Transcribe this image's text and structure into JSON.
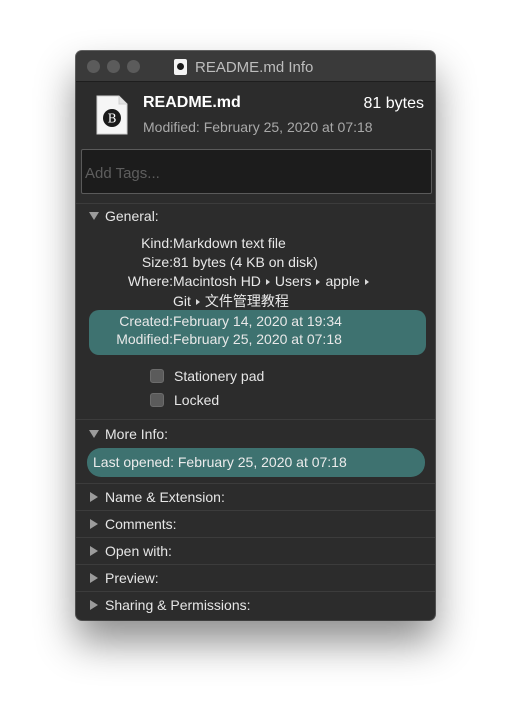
{
  "window": {
    "title": "README.md Info"
  },
  "header": {
    "file_name": "README.md",
    "file_size": "81 bytes",
    "modified": "Modified: February 25, 2020 at 07:18",
    "icon_letter": "B"
  },
  "tags": {
    "placeholder": "Add Tags..."
  },
  "general": {
    "title": "General:",
    "kind_label": "Kind:",
    "kind_value": "Markdown text file",
    "size_label": "Size:",
    "size_value": "81 bytes (4 KB on disk)",
    "where_label": "Where:",
    "where_path": [
      "Macintosh HD",
      "Users",
      "apple",
      "Git",
      "文件管理教程"
    ],
    "created_label": "Created:",
    "created_value": "February 14, 2020 at 19:34",
    "modified_label": "Modified:",
    "modified_value": "February 25, 2020 at 07:18",
    "stationery_label": "Stationery pad",
    "locked_label": "Locked"
  },
  "more_info": {
    "title": "More Info:",
    "last_opened_label": "Last opened:",
    "last_opened_value": "February 25, 2020 at 07:18"
  },
  "sections": {
    "name_extension": "Name & Extension:",
    "comments": "Comments:",
    "open_with": "Open with:",
    "preview": "Preview:",
    "sharing": "Sharing & Permissions:"
  },
  "colors": {
    "window_bg": "#2c2c2c",
    "highlight": "#3e7270",
    "text": "#e8e8e8"
  }
}
